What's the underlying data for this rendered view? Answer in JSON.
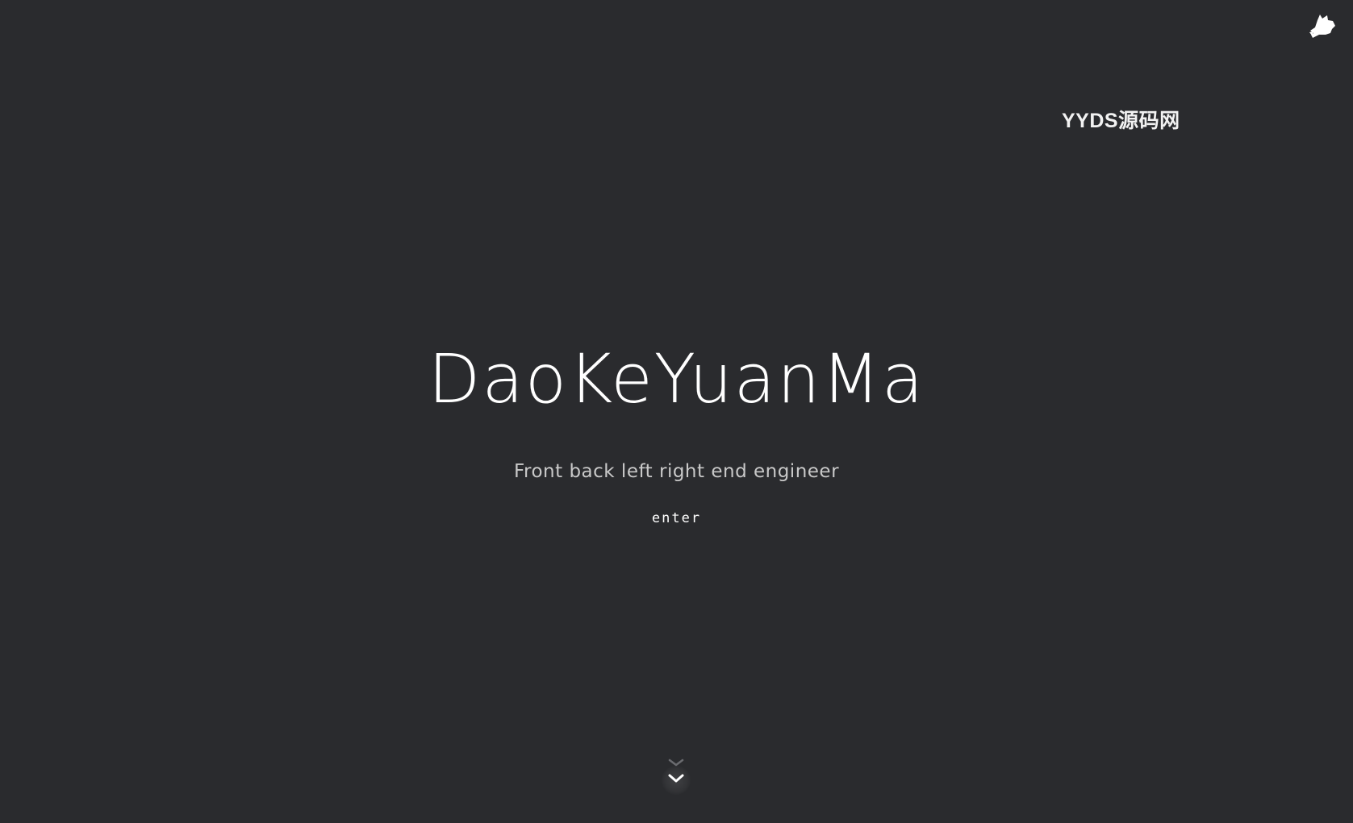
{
  "header": {
    "logo_icon": "cat-icon",
    "watermark": "YYDS源码网"
  },
  "hero": {
    "title": "DaoKeYuanMa",
    "subtitle": "Front back left right end engineer",
    "enter_label": "enter"
  },
  "scroll": {
    "icon": "chevron-down-icon"
  },
  "colors": {
    "background": "#2a2b2e",
    "title": "#ffffff",
    "subtitle": "#c9c9c9"
  }
}
